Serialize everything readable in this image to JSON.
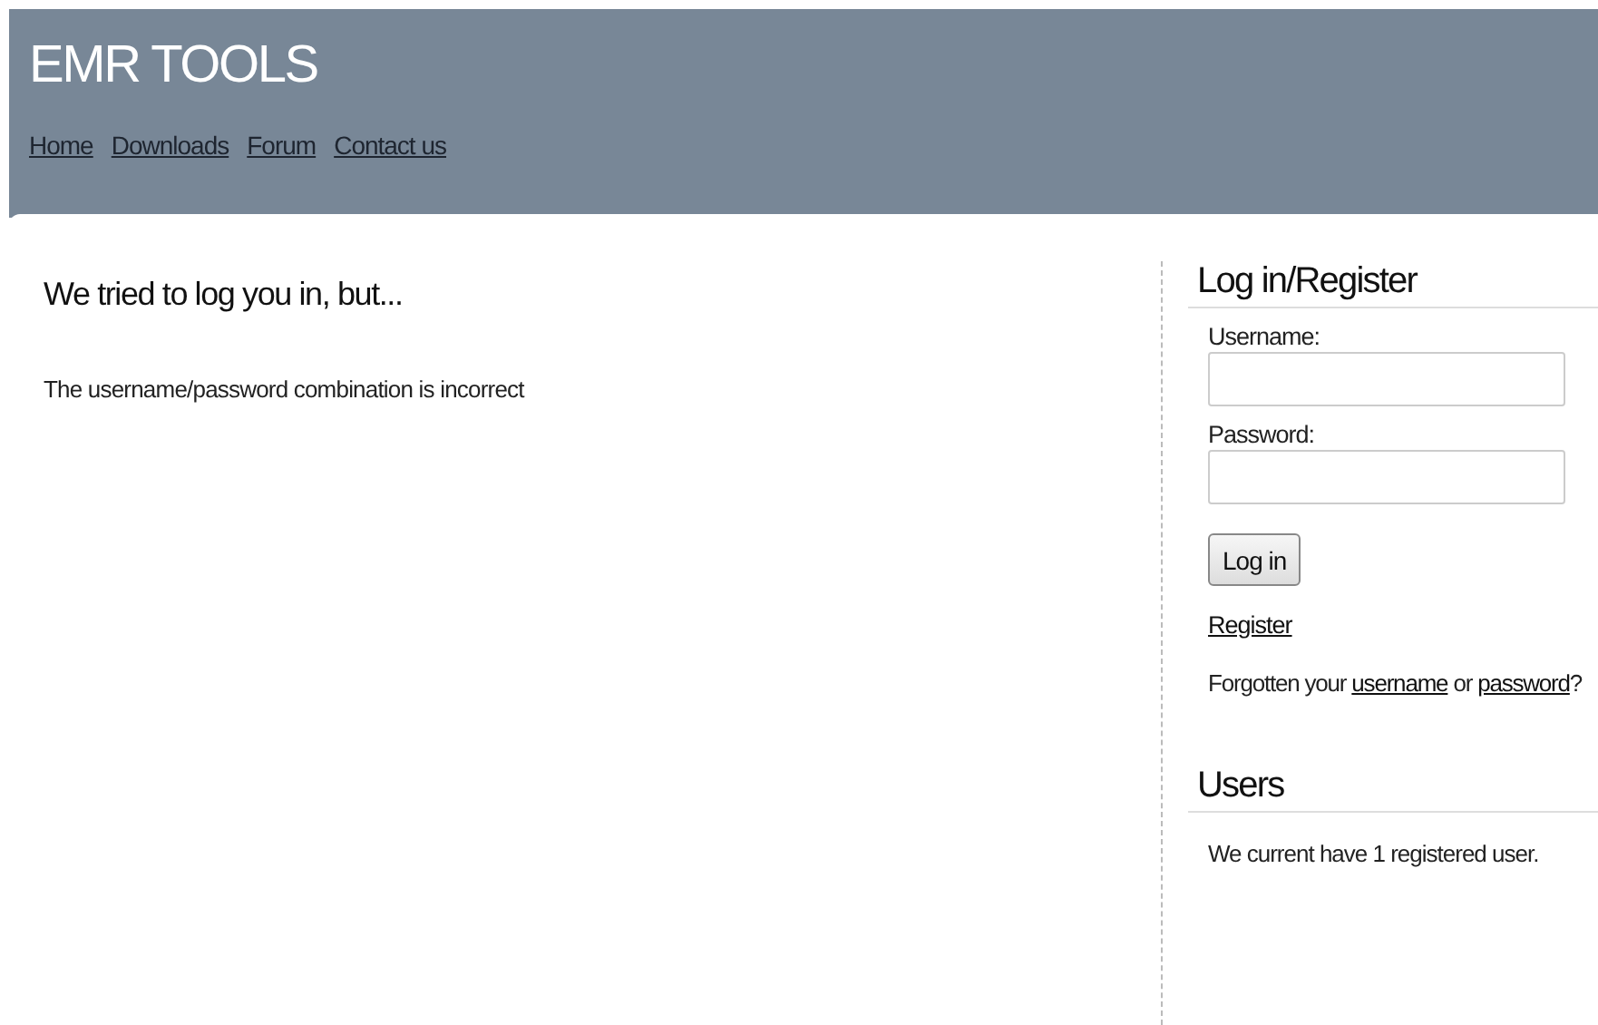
{
  "site_title": "EMR TOOLS",
  "nav": [
    {
      "label": "Home"
    },
    {
      "label": "Downloads"
    },
    {
      "label": "Forum"
    },
    {
      "label": "Contact us"
    }
  ],
  "main": {
    "heading": "We tried to log you in, but...",
    "message": "The username/password combination is incorrect"
  },
  "login": {
    "heading": "Log in/Register",
    "fields": [
      {
        "label": "Username:"
      },
      {
        "label": "Password:"
      }
    ],
    "button": "Log in",
    "register_link": "Register",
    "forgot": {
      "before": "Forgotten your",
      "link_1": "username",
      "middle": "or",
      "link_2": "password",
      "after": "?"
    }
  },
  "users": {
    "heading": "Users",
    "text": "We current have 1 registered user."
  }
}
